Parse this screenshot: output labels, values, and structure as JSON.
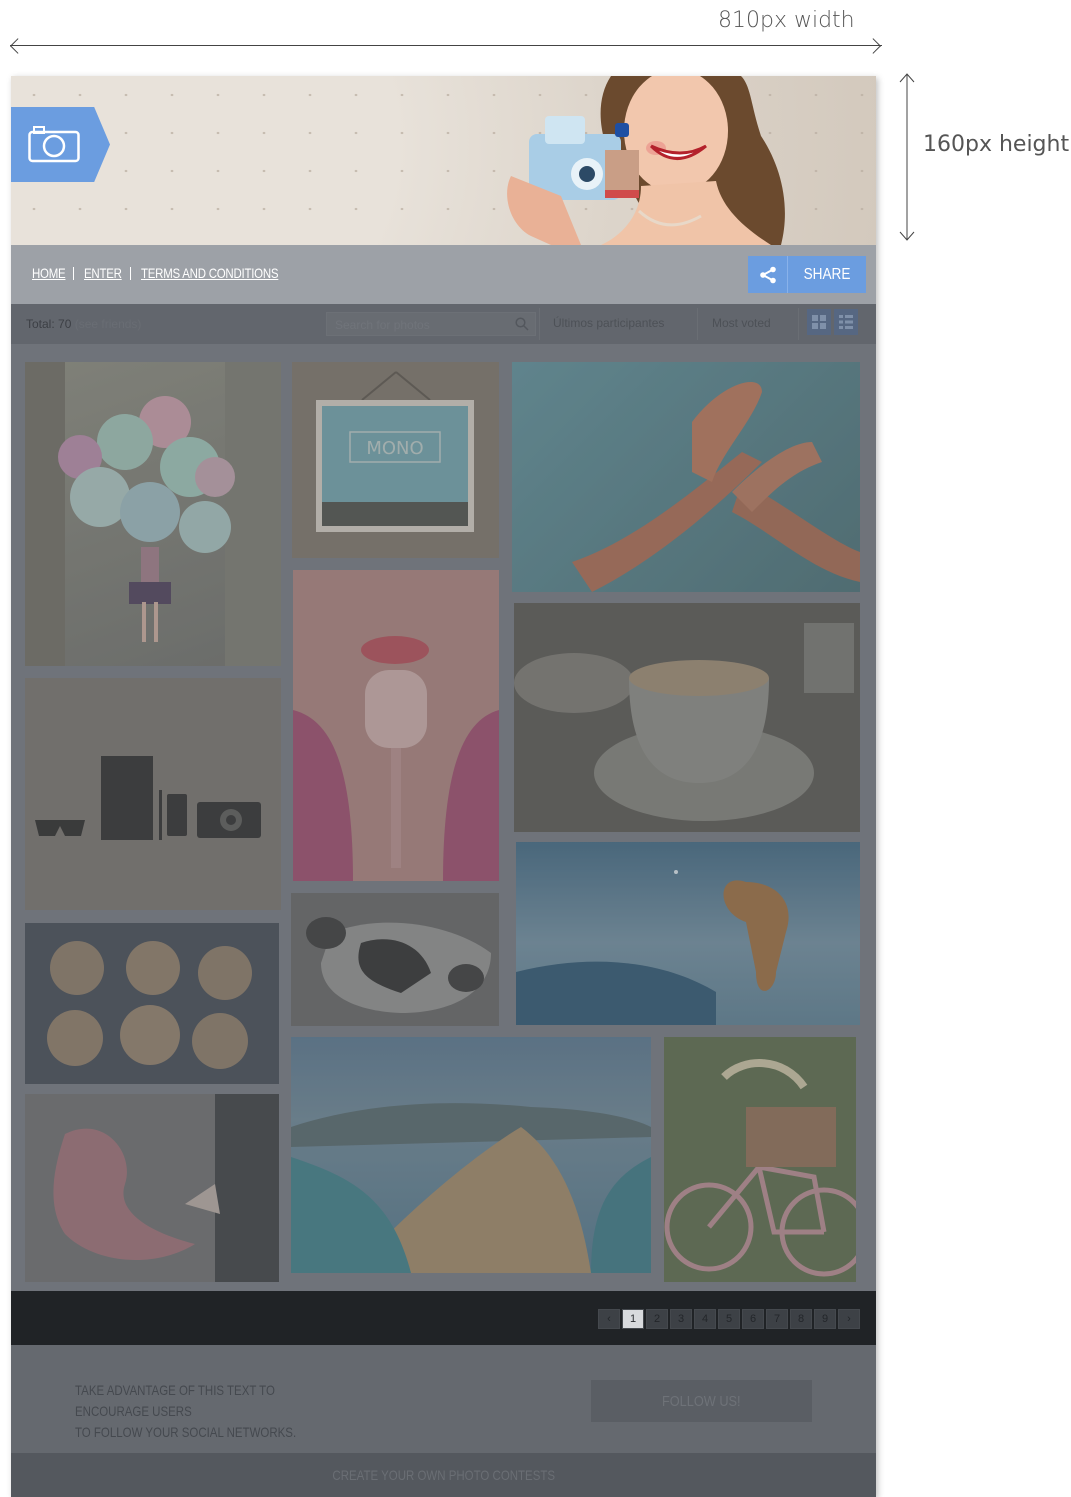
{
  "annotations": {
    "width_label": "810px width",
    "height_label": "160px height"
  },
  "banner": {
    "logo_icon": "camera-icon"
  },
  "nav": {
    "links": [
      "HOME",
      "ENTER",
      "TERMS AND CONDITIONS"
    ],
    "share_label": "SHARE",
    "share_icon": "share-icon"
  },
  "filters": {
    "total_label": "Total: 70",
    "friends_label": "(see friends)",
    "search_placeholder": "Search for photos",
    "tabs": [
      "Últimos participantes",
      "Most voted"
    ],
    "view_icons": [
      "grid-view-icon",
      "list-view-icon"
    ]
  },
  "gallery": {
    "photos": [
      "balloons-girl",
      "mono-sign",
      "peace-hands",
      "lips-popsicle",
      "coffee-cup",
      "gadgets",
      "tiger",
      "cow",
      "golf-balls",
      "pink-dress",
      "coastline",
      "pink-bicycle"
    ]
  },
  "pagination": {
    "prev": "‹",
    "pages": [
      "1",
      "2",
      "3",
      "4",
      "5",
      "6",
      "7",
      "8",
      "9"
    ],
    "next": "›",
    "current": "1"
  },
  "footer": {
    "text_line1": "TAKE ADVANTAGE OF THIS TEXT TO ENCOURAGE USERS",
    "text_line2": "TO FOLLOW YOUR SOCIAL NETWORKS.",
    "follow_label": "FOLLOW US!",
    "bottom_label": "CREATE YOUR OWN PHOTO CONTESTS"
  },
  "colors": {
    "accent": "#6b9de0",
    "nav_bg": "#9da1a7",
    "overlay": "#74787e",
    "pager_bg": "#202326"
  }
}
